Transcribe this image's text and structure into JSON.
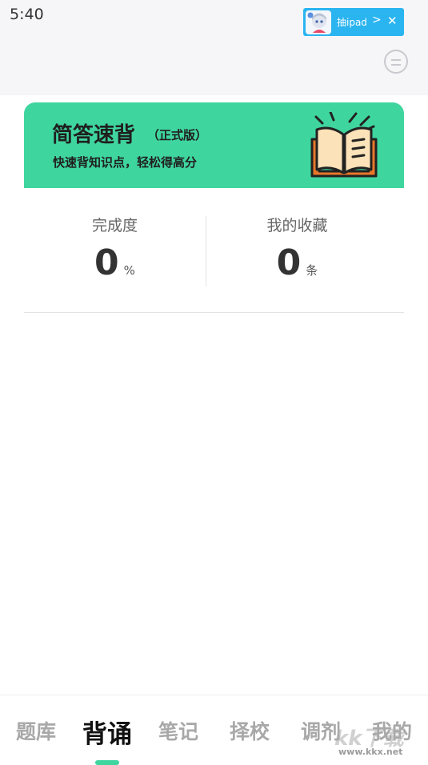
{
  "status_bar": {
    "time": "5:40"
  },
  "ad_badge": {
    "label": "抽ipad",
    "chevron": ">",
    "close": "✕"
  },
  "header": {
    "switch_icon": "switch-icon"
  },
  "banner": {
    "title": "简答速背",
    "edition": "（正式版）",
    "subtitle": "快速背知识点，轻松得高分",
    "icon": "book-icon",
    "color": "#3fd59f"
  },
  "stats": {
    "completion": {
      "label": "完成度",
      "value": "0",
      "unit": "%"
    },
    "favorites": {
      "label": "我的收藏",
      "value": "0",
      "unit": "条"
    }
  },
  "bottom_nav": {
    "items": [
      {
        "label": "题库"
      },
      {
        "label": "背诵"
      },
      {
        "label": "笔记"
      },
      {
        "label": "择校"
      },
      {
        "label": "调剂"
      },
      {
        "label": "我的"
      }
    ],
    "active_index": 1,
    "active_color": "#3fd59f"
  },
  "watermark": {
    "logo": "kk下载",
    "url": "www.kkx.net"
  }
}
